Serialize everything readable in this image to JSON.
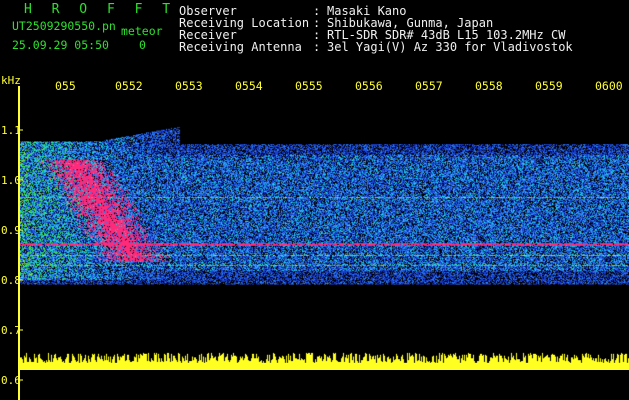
{
  "header": {
    "title": "H R O F F T",
    "filename": "UT2509290550.pn",
    "datetime": "25.09.29 05:50",
    "counter": "0",
    "meteor_label": "meteor",
    "fields": [
      {
        "label": "Observer",
        "sep": ":",
        "value": "Masaki Kano"
      },
      {
        "label": "Receiving Location",
        "sep": ":",
        "value": "Shibukawa, Gunma, Japan"
      },
      {
        "label": "Receiver",
        "sep": ":",
        "value": "RTL-SDR SDR# 43dB L15 103.2MHz CW"
      },
      {
        "label": "Receiving Antenna",
        "sep": ":",
        "value": "3el Yagi(V) Az 330 for Vladivostok"
      }
    ]
  },
  "axis": {
    "y_unit": "kHz",
    "y_ticks": [
      "1.1",
      "1.0",
      "0.9",
      "0.8",
      "0.7",
      "0.6"
    ],
    "x_ticks": [
      "055",
      "0552",
      "0553",
      "0554",
      "0555",
      "0556",
      "0557",
      "0558",
      "0559",
      "0600"
    ]
  },
  "colors": {
    "background": "#000000",
    "text": "#f0f0f0",
    "title_green": "#2fe02f",
    "axis_yellow": "#ffff33",
    "meteor_pink": "#ff2a7a",
    "noise_blue": "#1a3fd0"
  }
}
